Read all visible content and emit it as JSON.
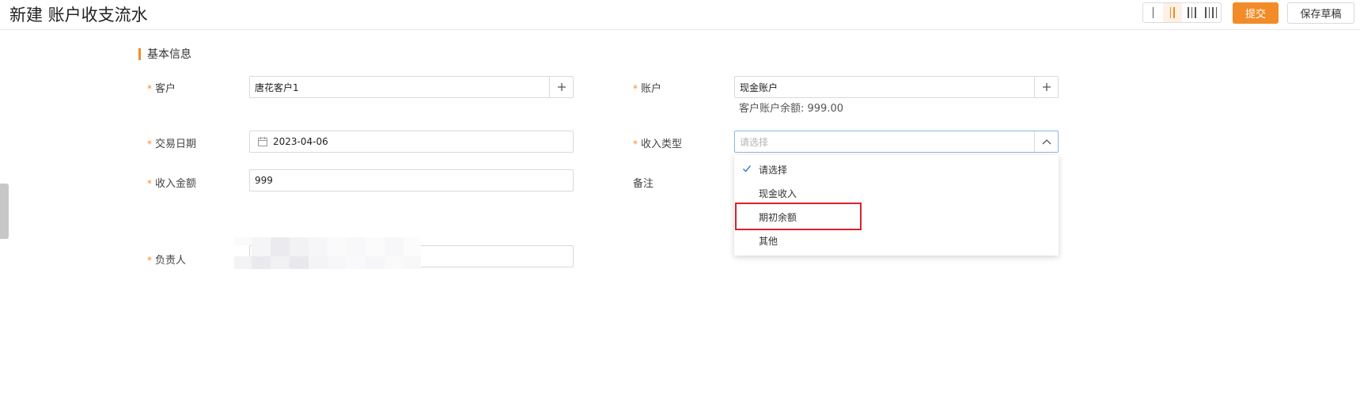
{
  "page": {
    "title": "新建 账户收支流水"
  },
  "toolbar": {
    "layouts": [
      {
        "name": "layout-1-column",
        "bars": 1,
        "active": false
      },
      {
        "name": "layout-2-column",
        "bars": 2,
        "active": true
      },
      {
        "name": "layout-3-column",
        "bars": 3,
        "active": false
      },
      {
        "name": "layout-4-column",
        "bars": 4,
        "active": false
      }
    ],
    "submit_label": "提交",
    "draft_label": "保存草稿"
  },
  "section": {
    "title": "基本信息"
  },
  "form": {
    "required_mark": "*",
    "customer": {
      "label": "客户",
      "value": "唐花客户1"
    },
    "account": {
      "label": "账户",
      "value": "现金账户",
      "balance_hint": "客户账户余额: 999.00"
    },
    "trade_date": {
      "label": "交易日期",
      "value": "2023-04-06"
    },
    "income_type": {
      "label": "收入类型",
      "placeholder": "请选择"
    },
    "income_amount": {
      "label": "收入金额",
      "value": "999"
    },
    "remark": {
      "label": "备注"
    },
    "owner": {
      "label": "负责人"
    }
  },
  "dropdown": {
    "options": [
      "请选择",
      "现金收入",
      "期初余额",
      "其他"
    ],
    "selected_index": 0,
    "highlighted_index": 2
  },
  "colors": {
    "accent": "#f28c28",
    "highlight": "#d9222a",
    "focus_border": "#8fb6e8"
  }
}
